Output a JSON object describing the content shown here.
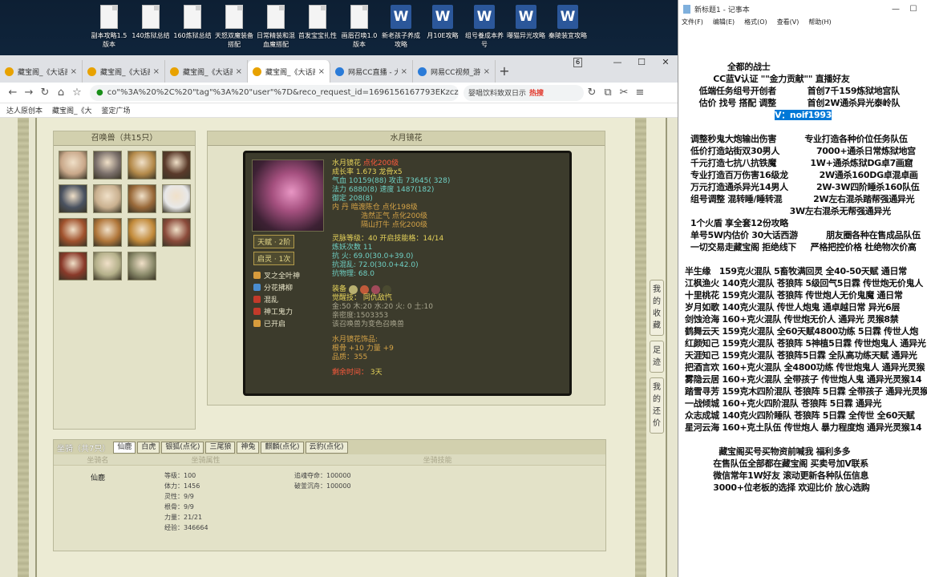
{
  "desktop": {
    "icons": [
      {
        "label": "副本攻略1.5版本",
        "type": "file"
      },
      {
        "label": "140炼狱总结",
        "type": "file"
      },
      {
        "label": "160炼狱总结",
        "type": "file"
      },
      {
        "label": "天怒双魔装备搭配",
        "type": "file"
      },
      {
        "label": "日常精装和混血魔搭配",
        "type": "file"
      },
      {
        "label": "首发宝宝扎性",
        "type": "file"
      },
      {
        "label": "画眉召唤1.0版本",
        "type": "file"
      },
      {
        "label": "新老孩子养成攻略",
        "type": "word"
      },
      {
        "label": "月10E攻略",
        "type": "word"
      },
      {
        "label": "组号養成本养号",
        "type": "word"
      },
      {
        "label": "曝猫异光攻略",
        "type": "word"
      },
      {
        "label": "秦陵装宜攻略",
        "type": "word"
      }
    ]
  },
  "browser": {
    "tabs": [
      {
        "label": "藏宝阁_《大话西",
        "active": false
      },
      {
        "label": "藏宝阁_《大话西",
        "active": false
      },
      {
        "label": "藏宝阁_《大话西",
        "active": false
      },
      {
        "label": "藏宝阁_《大话西",
        "active": true
      },
      {
        "label": "网易CC直播 - 大",
        "active": false
      },
      {
        "label": "网易CC视频_游戏",
        "active": false
      }
    ],
    "tab_count": "6",
    "url": "co\"%3A%20%2C%20\"tag\"%3A%20\"user\"%7D&reco_request_id=1696156167793EKzcz",
    "search_text": "婴唱饮料致双日示",
    "search_hot": "热搜",
    "bookmarks": [
      "达人原创本",
      "藏宝阁_《大",
      "鉴定广场"
    ]
  },
  "game": {
    "pet_list_title": "召唤兽（共15只）",
    "pets": [
      {
        "color": "#c9a88a"
      },
      {
        "color": "#7a6f6a"
      },
      {
        "color": "#b48a4a"
      },
      {
        "color": "#5a3a2a"
      },
      {
        "color": "#4a5260"
      },
      {
        "color": "#c9b08f"
      },
      {
        "color": "#9a6a3a"
      },
      {
        "color": "#e8e8e8"
      },
      {
        "color": "#a0522d"
      },
      {
        "color": "#b0763a"
      },
      {
        "color": "#c28a3a"
      },
      {
        "color": "#8a4a3a"
      },
      {
        "color": "#8a3a2a"
      },
      {
        "color": "#b4b08a"
      },
      {
        "color": "#8a8a6a"
      }
    ],
    "detail_title": "水月镜花",
    "pet": {
      "name": "水月镜花",
      "name_tag": "点化200级",
      "growth": "成长率 1.673 龙骨x5",
      "hp": "气血 10159(88) 攻击 73645( 328)",
      "mp": "法力 6880(8) 速度 1487(182)",
      "def": "御定 208(8)",
      "inner": "内  丹 暗渡陈仓 点化198级",
      "inner2": "浩然正气 点化200级",
      "inner3": "隔山打牛 点化200级",
      "spirit": "灵脉等级：40 开启技能格：14/14",
      "refine": "炼妖次数 11",
      "resist_fire": "抗  火: 69.0(30.0+39.0)",
      "resist_chaos": "抗混乱: 72.0(30.0+42.0)",
      "resist_phys": "抗物理: 68.0",
      "equip_label": "装备",
      "awaken": "觉醒技：  同仇敌忾",
      "elements": "金:50 木:20 水:20 火: 0 土:10",
      "exp": "亲密度:1503353",
      "convert": "该召唤兽为变色召唤兽",
      "ornament_title": "水月镜花饰品:",
      "ornament_attr": "根骨 +10 力量 +9",
      "ornament_quality": "品质：355",
      "remain_label": "剩余时间：",
      "remain_value": "3天",
      "tag_talent": "天赋 · 2阶",
      "tag_spirit": "启灵 · 1次",
      "skills": [
        "叉之全叶神",
        "分花拂柳",
        "混乱",
        "神工鬼力",
        "已开启"
      ]
    },
    "mount": {
      "title": "坐骑（共7只）",
      "tabs": [
        "仙鹿",
        "白虎",
        "银狐(点化)",
        "三尾狼",
        "神兔",
        "麒麟(点化)",
        "云豹(点化)"
      ],
      "head_name": "坐骑名",
      "head_attr": "坐骑属性",
      "head_skill": "坐骑技能",
      "name": "仙鹿",
      "attrs": [
        "等级：100",
        "体力：1456",
        "灵性：9/9",
        "根骨：9/9",
        "力量：21/21",
        "经验：346664"
      ],
      "skills": [
        "追魂夺命：100000",
        "破釜沉舟：100000"
      ]
    },
    "side_buttons": [
      "我的收藏",
      "足迹",
      "我的还价"
    ]
  },
  "notepad": {
    "title": "新标题1 - 记事本",
    "menu": [
      "文件(F)",
      "编辑(E)",
      "格式(O)",
      "查看(V)",
      "帮助(H)"
    ],
    "lines": [
      "               全都的战士",
      "          CC蓝V认证 \"\"金力贡献\"\" 直播好友",
      "     低端任务组号开创者           首创7千159炼狱地宫队",
      "     估价 找号 搭配 调整           首创2W通杀异光泰岭队",
      "",
      "  调整秒鬼大炮输出伤害          专业打造各种价位任务队伍",
      "  低价打造站街双30男人             7000+通杀日常炼狱地宫",
      "  千元打造七抗八抗铁魔            1W+通杀炼狱DG卓7画窟",
      "  专业打造百万伤害16级龙           2W通杀160DG卓混卓画",
      "  万元打造通杀异光14男人          2W-3W四阶睡杀160队伍",
      "  组号调整 混转睡/睡转混           2W左右混杀踏帮强通异光",
      "                                     3W左右混杀无帮强通异光",
      "  1个火盾 享全套12份攻略",
      "  单号5W内估价 30大话西游          朋友圈各种在售成品队伍",
      "  一切交易走藏宝阁 拒绝线下     严格把控价格 杜绝物次价高",
      "",
      "半生缘   159克火混队 5畜牧满回灵 全40-50天赋 通日常",
      "江枫渔火 140克火混队 苍狼阵 5级回气5日霖 传世炮无价鬼人",
      "十里桃花 159克火混队 苍狼阵 传世炮人无价鬼魔 通日常",
      "岁月如歌 140克火混队 传世人炮鬼 通卓越日常 异光6层",
      "剑蚀沧海 160+克火混队 传世炮无价人 通异光 灵猴8禁",
      "鹤舞云天 159克火混队 全60天赋4800功练 5日霖 传世人炮",
      "红颜知己 159克火混队 苍狼阵 5神植5日霖 传世炮鬼人 通异光",
      "天涯知己 159克火混队 苍狼阵5日霖 全队高功练天赋 通异光",
      "把酒言欢 160+克火混队 全4800功练 传世炮鬼人 通异光灵猴",
      "雾隐云居 160+克火混队 全带孩子 传世炮人鬼 通异光灵猴14",
      "踏雪寻芳 159克木四阶混队 苍狼阵 5日霖 全带孩子 通异光灵猴",
      "一战倾城 160+克火四阶混队 苍狼阵 5日霖 通异光",
      "众志成城 140克火四阶睡队 苍狼阵 5日霖 全传世 全60天赋",
      "星河云海 160+克土队伍 传世炮人 暴力程度炮 通异光灵猴14",
      "",
      "            藏宝阁买号买物资前喊我 福利多多",
      "          在售队伍全部都在藏宝阁 买卖号加V联系",
      "          微信常年1W好友 滚动更新各种队伍信息",
      "          3000+位老板的选择 欢迎比价 放心选购"
    ],
    "highlight": "V：noif1993"
  }
}
